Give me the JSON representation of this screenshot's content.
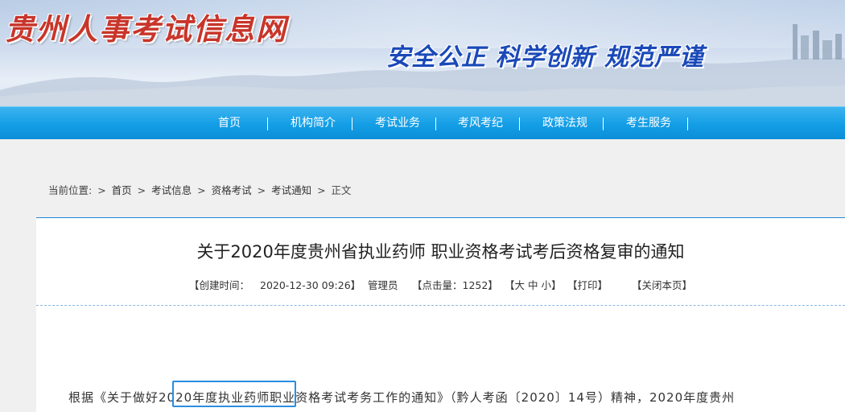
{
  "site": {
    "title": "贵州人事考试信息网",
    "slogan": "安全公正  科学创新  规范严谨"
  },
  "nav": {
    "items": [
      {
        "label": "首页"
      },
      {
        "label": "机构简介"
      },
      {
        "label": "考试业务"
      },
      {
        "label": "考风考纪"
      },
      {
        "label": "政策法规"
      },
      {
        "label": "考生服务"
      }
    ]
  },
  "breadcrumb": {
    "prefix": "当前位置:",
    "sep": ">",
    "items": [
      "首页",
      "考试信息",
      "资格考试",
      "考试通知",
      "正文"
    ]
  },
  "article": {
    "title": "关于2020年度贵州省执业药师 职业资格考试考后资格复审的通知",
    "meta": {
      "created_label": "【创建时间：",
      "created_value": "2020-12-30 09:26】",
      "author": "管理员",
      "hits": "【点击量：1252】",
      "size": "【大 中 小】",
      "print": "【打印】",
      "close": "【关闭本页】"
    },
    "body_first_line": "根据《关于做好2020年度执业药师职业资格考试考务工作的通知》（黔人考函〔2020〕14号）精神，2020年度贵州"
  },
  "colors": {
    "nav_bg": "#139ee6",
    "title_red": "#c8352a",
    "slogan_blue": "#1a49b8",
    "accent_line": "#1f87d6"
  }
}
